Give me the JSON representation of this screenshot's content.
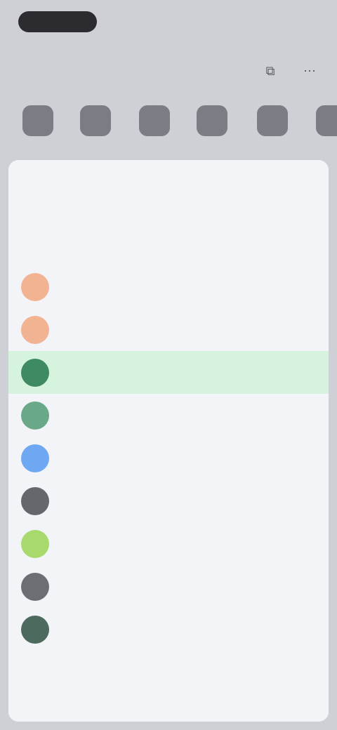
{
  "status_bar": {
    "time": "",
    "right": ""
  },
  "header": {
    "title": ""
  },
  "share_targets": [
    {
      "label": ""
    },
    {
      "label": ""
    },
    {
      "label": ""
    },
    {
      "label": ""
    },
    {
      "label": ""
    },
    {
      "label": ""
    }
  ],
  "sheet": {
    "title": "",
    "action": "",
    "description": "",
    "items": [
      {
        "label": "",
        "color": "#f2b392"
      },
      {
        "label": "",
        "color": "#f2b392"
      },
      {
        "label": "",
        "color": "#3e8a62",
        "selected": true
      },
      {
        "label": "",
        "color": "#6aa987"
      },
      {
        "label": "",
        "color": "#6fa8f2"
      },
      {
        "label": "",
        "color": "#66676d"
      },
      {
        "label": "",
        "color": "#a7d96c"
      },
      {
        "label": "",
        "color": "#6d6e73"
      },
      {
        "label": "",
        "color": "#4c6a5e"
      }
    ],
    "more_label": ""
  },
  "colors": {
    "accent": "#5aa9e6",
    "selected_bg": "#d6f3dd",
    "sheet_bg": "#f3f4f8"
  }
}
